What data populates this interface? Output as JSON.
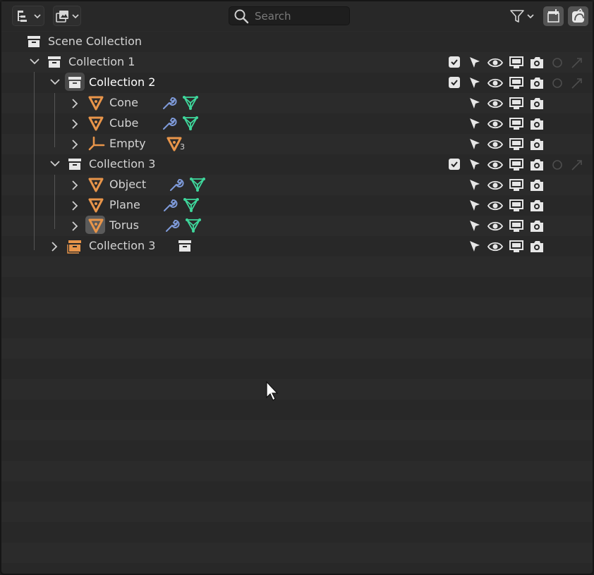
{
  "header": {
    "search_placeholder": "Search"
  },
  "tree": {
    "scene_collection": "Scene Collection",
    "collection1": "Collection 1",
    "collection2": "Collection 2",
    "cone": "Cone",
    "cube": "Cube",
    "empty": "Empty",
    "empty_badge_count": "3",
    "collection3": "Collection 3",
    "object": "Object",
    "plane": "Plane",
    "torus": "Torus",
    "collection3b": "Collection 3"
  },
  "colors": {
    "mesh_orange": "#e8954a",
    "modifier_blue": "#7e9ad9",
    "vertex_green": "#3fd79c",
    "icon_white": "#e6e6e6"
  },
  "icons": [
    "display-mode-icon",
    "view-layer-icon",
    "search-icon",
    "filter-icon",
    "new-collection-icon",
    "restriction-toggle-icon",
    "collection-icon",
    "mesh-icon",
    "empty-icon",
    "wrench-icon",
    "vertex-group-icon",
    "pointer-icon",
    "eye-icon",
    "monitor-icon",
    "camera-icon",
    "holdout-icon",
    "indirect-only-icon",
    "mouse-cursor-icon"
  ]
}
